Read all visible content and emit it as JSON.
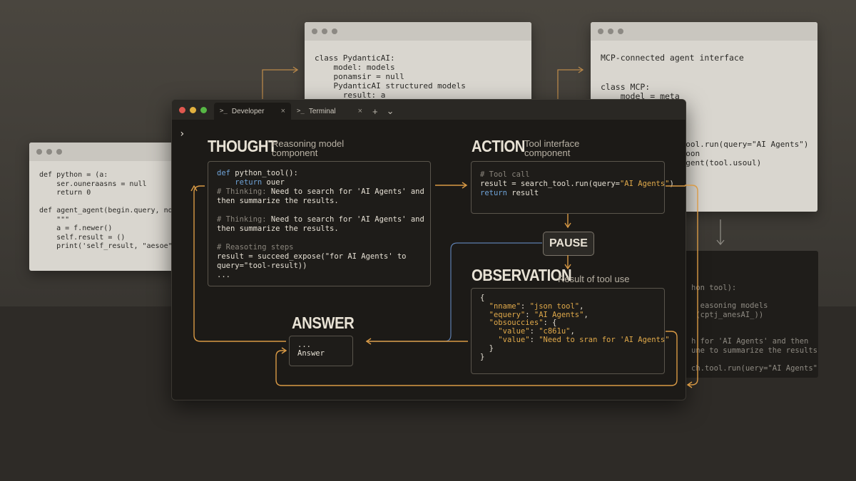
{
  "background": {
    "win1_code": "class PydanticAI:\n    model: models\n    ponamsir = null\n    PydanticAI structured models\n      result: a",
    "win2_code": "MCP-connected agent interface\n\n\nclass MCP:\n    model = meta",
    "win2_partial": "r\n tool.run(query=\"AI Agents\")\n soon\n agent(tool.usoul)",
    "win3_code": "def python = (a:\n    ser.ouneraasns = null\n    return 0\n\ndef agent_agent(begin.query, not\n    \"\"\"\n    a = f.newer()\n    self.result = ()\n    print('self_result, \"aesoe\")",
    "win4_code": "hon tool):\n\n  easoning models\n (cptj_anesAI_))\n\n\nh for 'AI Agents' and then\nune to summarize the results.\n\nch.tool.run(uery=\"AI Agents\")"
  },
  "window": {
    "tabs": [
      {
        "label": "Developer",
        "icon": "terminal-icon",
        "active": true
      },
      {
        "label": "Terminal",
        "icon": "terminal-icon",
        "active": false
      }
    ],
    "add_tab": "+",
    "dropdown": "⌄",
    "prompt": "›"
  },
  "thought": {
    "title": "THOUGHT",
    "subtitle": "Reasoning model component",
    "code": [
      {
        "t": "def ",
        "c": "kw"
      },
      {
        "t": "python_tool():\n"
      },
      {
        "t": "    "
      },
      {
        "t": "return",
        "c": "kw"
      },
      {
        "t": " ouer\n"
      },
      {
        "t": "# Thinking: ",
        "c": "cm"
      },
      {
        "t": "Need to search for 'AI Agents' and\nthen summarize the results.\n\n"
      },
      {
        "t": "# Thinking: ",
        "c": "cm"
      },
      {
        "t": "Need to search for 'AI Agents' and\nthen summarize the results.\n\n"
      },
      {
        "t": "# Reasoting steps\n",
        "c": "cm"
      },
      {
        "t": "result = succeed_expose(\"for AI Agents' to\nquery=\"tool-result))\n..."
      }
    ]
  },
  "action": {
    "title": "ACTION",
    "subtitle": "Tool interface component",
    "code": [
      {
        "t": "# Tool call\n",
        "c": "cm"
      },
      {
        "t": "result = search_tool.run(query="
      },
      {
        "t": "\"AI Agents\"",
        "c": "st"
      },
      {
        "t": ")\n"
      },
      {
        "t": "return",
        "c": "kw"
      },
      {
        "t": " result"
      }
    ]
  },
  "pause": {
    "label": "PAUSE"
  },
  "observation": {
    "title": "OBSERVATION",
    "subtitle": "Result of tool use",
    "code": [
      {
        "t": "{\n  "
      },
      {
        "t": "\"nname\"",
        "c": "st"
      },
      {
        "t": ": "
      },
      {
        "t": "\"json tool\"",
        "c": "st"
      },
      {
        "t": ",\n  "
      },
      {
        "t": "\"equery\"",
        "c": "st"
      },
      {
        "t": ": "
      },
      {
        "t": "\"AI Agents\"",
        "c": "st"
      },
      {
        "t": ",\n  "
      },
      {
        "t": "\"obsouccies\"",
        "c": "st"
      },
      {
        "t": ": {\n    "
      },
      {
        "t": "\"value\"",
        "c": "st"
      },
      {
        "t": ": "
      },
      {
        "t": "\"c861u\"",
        "c": "st"
      },
      {
        "t": ",\n    "
      },
      {
        "t": "\"value\"",
        "c": "st"
      },
      {
        "t": ": "
      },
      {
        "t": "\"Need to sran for 'AI Agents\"",
        "c": "st"
      },
      {
        "t": "\n  }\n}"
      }
    ]
  },
  "answer": {
    "title": "ANSWER",
    "code": "...\nAnswer"
  },
  "colors": {
    "accent_arrow": "#d99a45",
    "blue_line": "#5d7fb0"
  }
}
